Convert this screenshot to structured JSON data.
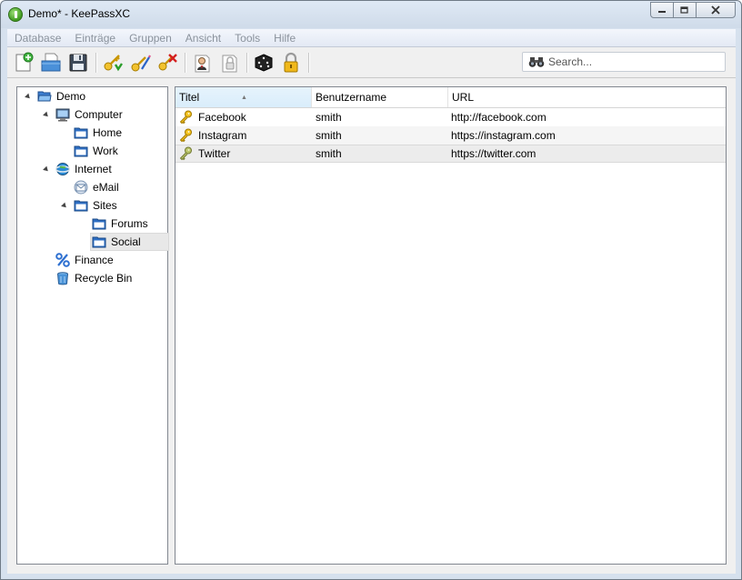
{
  "window": {
    "title": "Demo* - KeePassXC"
  },
  "menu": [
    "Database",
    "Einträge",
    "Gruppen",
    "Ansicht",
    "Tools",
    "Hilfe"
  ],
  "toolbar": {
    "buttons": [
      {
        "name": "new-database",
        "icon": "new-document-icon"
      },
      {
        "name": "open-database",
        "icon": "open-folder-icon"
      },
      {
        "name": "save-database",
        "icon": "floppy-disk-icon"
      },
      {
        "name": "add-entry",
        "icon": "key-add-icon"
      },
      {
        "name": "edit-entry",
        "icon": "key-edit-icon"
      },
      {
        "name": "delete-entry",
        "icon": "key-delete-icon"
      },
      {
        "name": "copy-username",
        "icon": "user-icon"
      },
      {
        "name": "copy-password",
        "icon": "password-copy-icon"
      },
      {
        "name": "password-generator",
        "icon": "dice-icon"
      },
      {
        "name": "lock-database",
        "icon": "padlock-icon"
      }
    ],
    "search_placeholder": "Search..."
  },
  "tree": [
    {
      "label": "Demo",
      "level": 0,
      "expanded": true,
      "icon": "folder-open-icon"
    },
    {
      "label": "Computer",
      "level": 1,
      "expanded": true,
      "icon": "monitor-icon"
    },
    {
      "label": "Home",
      "level": 2,
      "icon": "folder-icon"
    },
    {
      "label": "Work",
      "level": 2,
      "icon": "folder-icon"
    },
    {
      "label": "Internet",
      "level": 1,
      "expanded": true,
      "icon": "globe-icon"
    },
    {
      "label": "eMail",
      "level": 2,
      "icon": "envelope-icon"
    },
    {
      "label": "Sites",
      "level": 2,
      "expanded": true,
      "icon": "folder-icon"
    },
    {
      "label": "Forums",
      "level": 3,
      "icon": "folder-icon"
    },
    {
      "label": "Social",
      "level": 3,
      "icon": "folder-icon",
      "selected": true
    },
    {
      "label": "Finance",
      "level": 1,
      "icon": "percent-icon"
    },
    {
      "label": "Recycle Bin",
      "level": 1,
      "icon": "recycle-bin-icon"
    }
  ],
  "columns": [
    "Titel",
    "Benutzername",
    "URL"
  ],
  "entries": [
    {
      "title": "Facebook",
      "username": "smith",
      "url": "http://facebook.com"
    },
    {
      "title": "Instagram",
      "username": "smith",
      "url": "https://instagram.com"
    },
    {
      "title": "Twitter",
      "username": "smith",
      "url": "https://twitter.com",
      "selected": true
    }
  ]
}
